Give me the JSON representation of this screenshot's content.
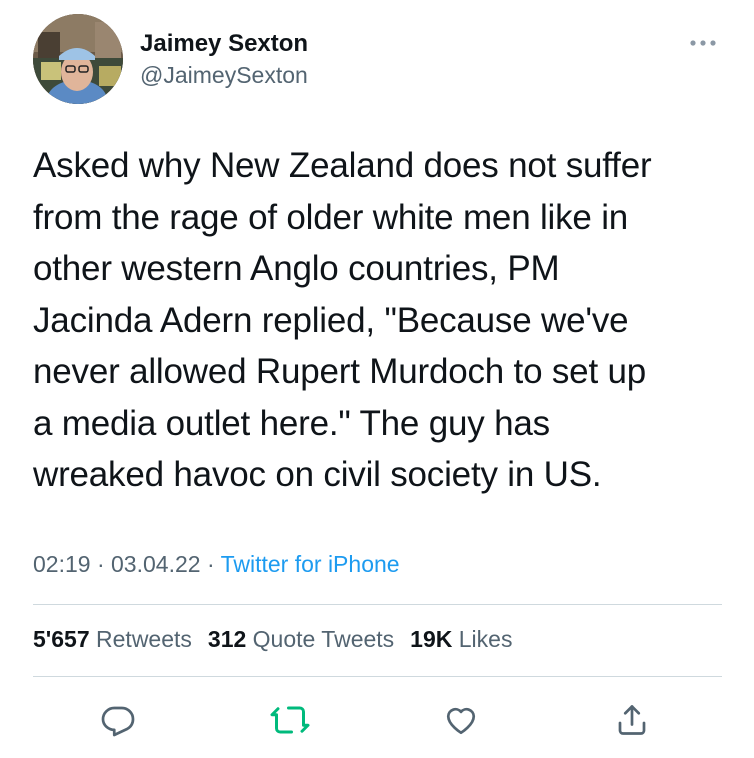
{
  "author": {
    "name": "Jaimey Sexton",
    "handle": "@JaimeySexton"
  },
  "tweet": {
    "text": "Asked why New Zealand does not suffer\nfrom the rage of older white men like in\nother western Anglo countries, PM\nJacinda Adern replied, \"Because we've\nnever allowed Rupert Murdoch to set up\na media outlet here.\" The guy has\nwreaked havoc on civil society in US."
  },
  "meta": {
    "time": "02:19",
    "separator": "·",
    "date": "03.04.22",
    "source": "Twitter for iPhone"
  },
  "stats": {
    "retweets_count": "5'657",
    "retweets_label": "Retweets",
    "quotes_count": "312",
    "quotes_label": "Quote Tweets",
    "likes_count": "19K",
    "likes_label": "Likes"
  },
  "colors": {
    "text": "#0f1419",
    "secondary": "#536471",
    "link": "#1d9bf0",
    "retweet_green": "#00ba7c",
    "divider": "#cfd9de"
  },
  "icons": {
    "more": "more-dots-icon",
    "reply": "reply-icon",
    "retweet": "retweet-icon",
    "like": "heart-icon",
    "share": "share-icon"
  }
}
